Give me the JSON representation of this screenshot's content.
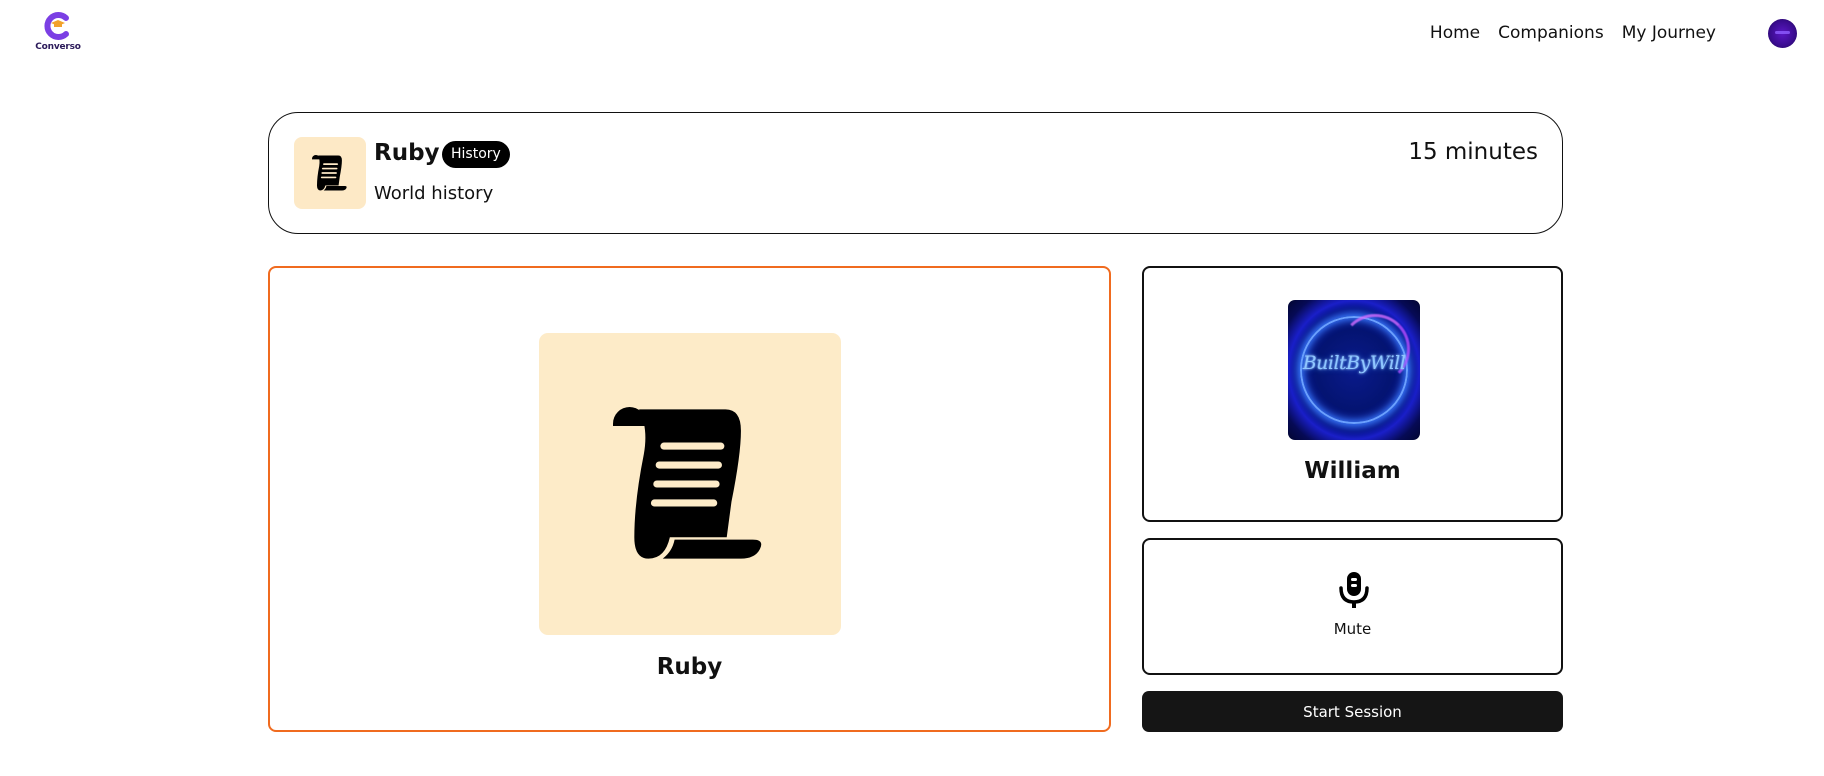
{
  "brand": {
    "name": "Converso",
    "accent": "#7b3fe4"
  },
  "nav": {
    "links": [
      "Home",
      "Companions",
      "My Journey"
    ]
  },
  "companion": {
    "name": "Ruby",
    "subject": "History",
    "topic": "World history",
    "duration": "15 minutes",
    "icon": "scroll-icon",
    "bg_color": "#fde9c6"
  },
  "session": {
    "companion_name": "Ruby",
    "user_name": "William",
    "user_avatar_text": "BuiltByWill",
    "mute_label": "Mute",
    "start_label": "Start Session",
    "highlight_color": "#f06b1f"
  }
}
